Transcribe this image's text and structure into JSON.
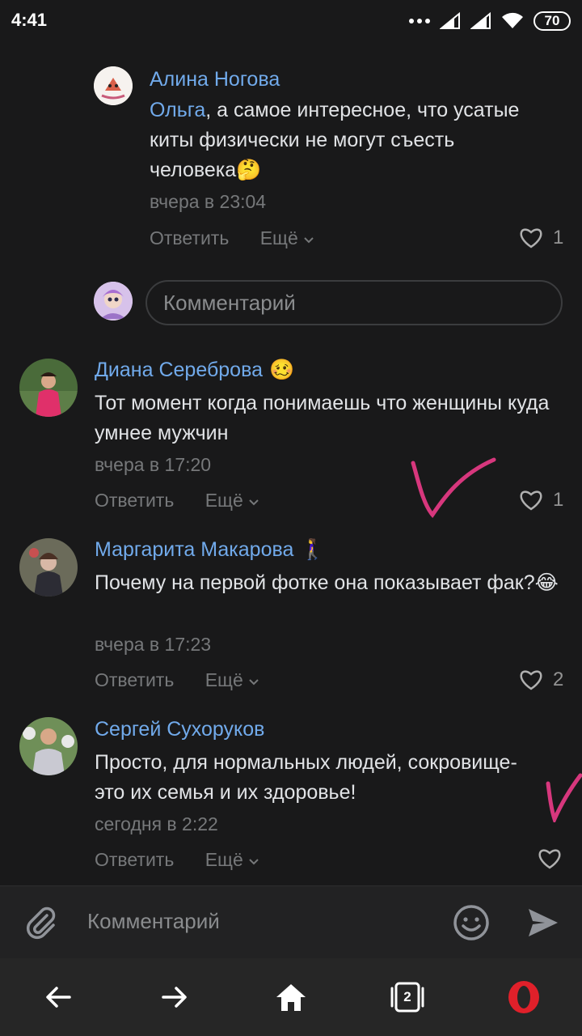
{
  "status_bar": {
    "time": "4:41",
    "battery": "70"
  },
  "comments": [
    {
      "name": "Алина Ногова",
      "name_emoji": "",
      "mention": "Ольга",
      "text": ", а самое интересное, что усатые киты физически не могут съесть человека🤔",
      "date": "вчера в 23:04",
      "reply": "Ответить",
      "more": "Ещё",
      "likes": "1"
    },
    {
      "name": "Диана Сереброва",
      "name_emoji": "🥴",
      "text": "Тот момент когда понимаешь что женщины куда умнее мужчин",
      "date": "вчера в 17:20",
      "reply": "Ответить",
      "more": "Ещё",
      "likes": "1"
    },
    {
      "name": "Маргарита Макарова",
      "name_emoji": "🚶‍♀️",
      "text": "Почему на первой фотке она показывает фак?😂",
      "date": "вчера в 17:23",
      "reply": "Ответить",
      "more": "Ещё",
      "likes": "2"
    },
    {
      "name": "Сергей Сухоруков",
      "name_emoji": "",
      "text": "Просто, для нормальных людей, сокровище-это их семья и их здоровье!",
      "date": "сегодня в 2:22",
      "reply": "Ответить",
      "more": "Ещё",
      "likes": ""
    }
  ],
  "reply_input": {
    "placeholder": "Комментарий"
  },
  "composer": {
    "placeholder": "Комментарий"
  },
  "browser_nav": {
    "tabs_count": "2"
  },
  "colors": {
    "accent": "#71aaeb",
    "background": "#19191a",
    "annotation": "#d7377d",
    "opera_red": "#e0202a"
  }
}
